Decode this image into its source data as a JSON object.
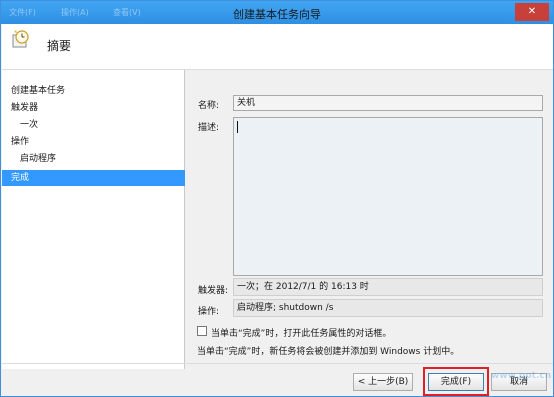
{
  "window": {
    "title": "创建基本任务向导",
    "titlebar_faded": [
      "文件(F)",
      "操作(A)",
      "查看(V)"
    ],
    "close_label": "✕",
    "accent_color": "#3399ff",
    "highlight_color": "#e31e24"
  },
  "header": {
    "title": "摘要",
    "icon": "task-clock-icon"
  },
  "nav": {
    "items": [
      {
        "label": "创建基本任务"
      },
      {
        "label": "触发器"
      },
      {
        "label": "一次"
      },
      {
        "label": "操作"
      },
      {
        "label": "启动程序"
      },
      {
        "label": "完成"
      }
    ]
  },
  "form": {
    "name_label": "名称:",
    "name_value": "关机",
    "description_label": "描述:",
    "description_value": "",
    "trigger_label": "触发器:",
    "trigger_value": "一次；在 2012/7/1 的 16:13 时",
    "action_label": "操作:",
    "action_value": "启动程序; shutdown /s"
  },
  "options": {
    "open_properties_label": "当单击“完成”时，打开此任务属性的对话框。",
    "open_properties_checked": false,
    "note": "当单击“完成”时，新任务将会被创建并添加到 Windows 计划中。"
  },
  "buttons": {
    "back": "< 上一步(B)",
    "finish": "完成(F)",
    "cancel": "取消"
  },
  "watermark": "www.ppt.cn"
}
